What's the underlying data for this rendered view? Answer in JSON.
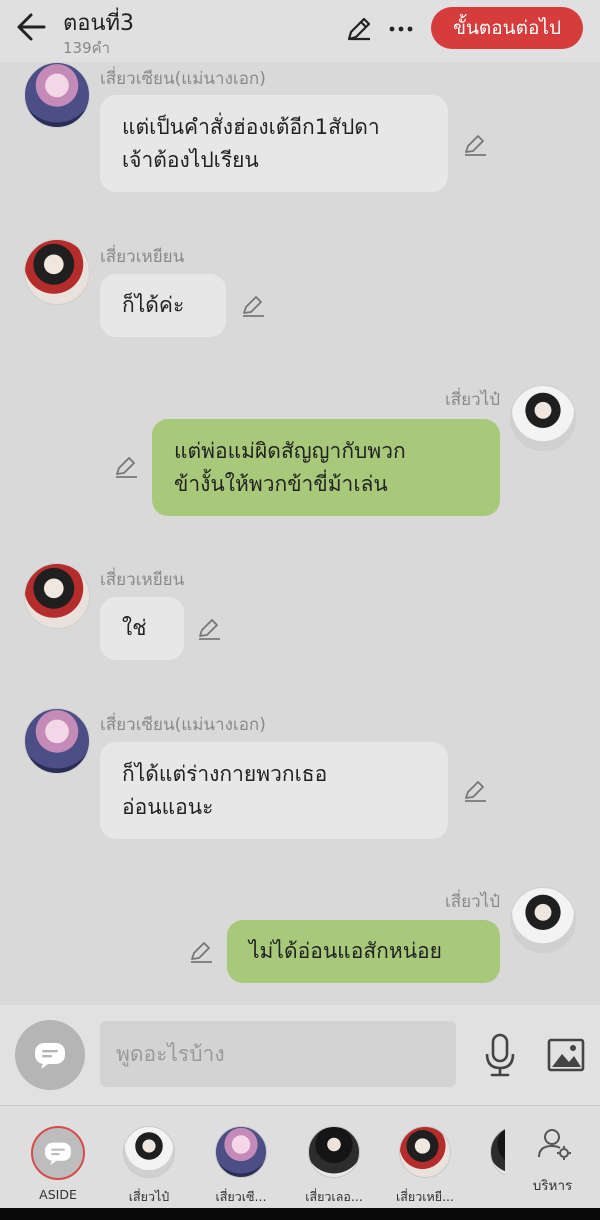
{
  "header": {
    "title": "ตอนที่3",
    "word_count": "139คำ",
    "next_button": "ขั้นตอนต่อไป",
    "accent_color": "#d63c3c"
  },
  "messages": [
    {
      "sender": "เสี่ยวเซียน(แม่นางเอก)",
      "text": "แต่เป็นคำสั่งฮ่องเต้อีก1สัปดา\nเจ้าต้องไปเรียน",
      "side": "left"
    },
    {
      "sender": "เสี่ยวเหยียน",
      "text": "ก็ได้ค่ะ",
      "side": "left"
    },
    {
      "sender": "เสี่ยวไป๋",
      "text": "แต่พ่อแม่ผิดสัญญากับพวก\nข้างั้นให้พวกข้าขี่ม้าเล่น",
      "side": "right"
    },
    {
      "sender": "เสี่ยวเหยียน",
      "text": "ใช่",
      "side": "left"
    },
    {
      "sender": "เสี่ยวเซียน(แม่นางเอก)",
      "text": "ก็ได้แต่ร่างกายพวกเธอ\nอ่อนแอนะ",
      "side": "left"
    },
    {
      "sender": "เสี่ยวไป๋",
      "text": "ไม่ได้อ่อนแอสักหน่อย",
      "side": "right"
    }
  ],
  "input": {
    "placeholder": "พูดอะไรบ้าง"
  },
  "characters": [
    {
      "label": "ASIDE"
    },
    {
      "label": "เสี่ยวไป๋"
    },
    {
      "label": "เสี่ยวเซี..."
    },
    {
      "label": "เสี่ยวเลอ..."
    },
    {
      "label": "เสี่ยวเหยี..."
    }
  ],
  "manage_label": "บริหาร",
  "colors": {
    "right_bubble": "#a8c87a",
    "left_bubble": "#e7e7e7",
    "background": "#d9d9d9"
  }
}
